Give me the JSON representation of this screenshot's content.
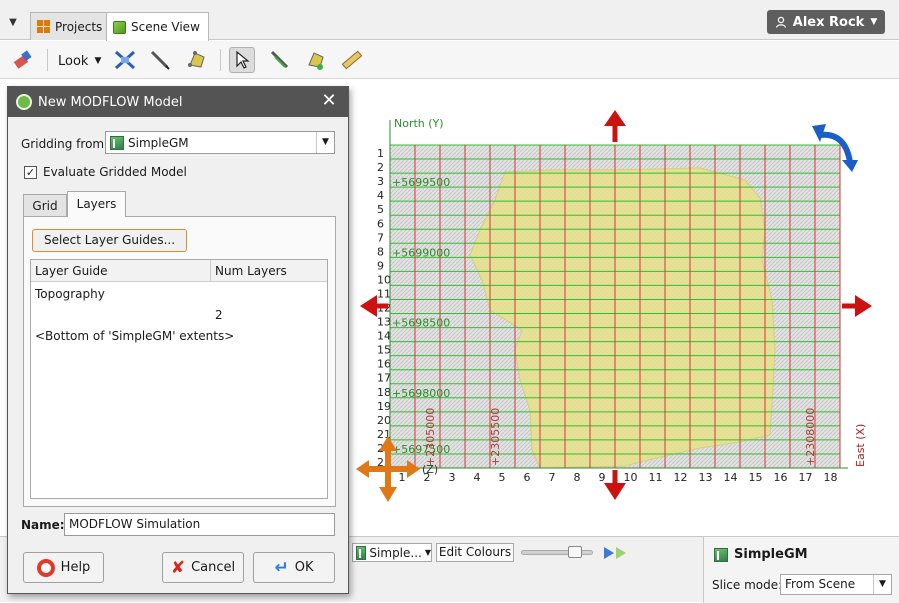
{
  "tabs": [
    {
      "label": "Projects",
      "icon": "projects-grid-icon"
    },
    {
      "label": "Scene View",
      "icon": "scene-cube-icon"
    }
  ],
  "user": {
    "name": "Alex Rock",
    "icon": "user-icon"
  },
  "toolbar": {
    "look_label": "Look"
  },
  "scene": {
    "north_label": "North (Y)",
    "east_label": "East (X)",
    "z_label": "(Z)",
    "row_labels": [
      "1",
      "2",
      "3",
      "4",
      "5",
      "6",
      "7",
      "8",
      "9",
      "10",
      "11",
      "12",
      "13",
      "14",
      "15",
      "16",
      "17",
      "18",
      "19",
      "20",
      "21",
      "22",
      "23"
    ],
    "col_labels": [
      "1",
      "2",
      "3",
      "4",
      "5",
      "6",
      "7",
      "8",
      "9",
      "10",
      "11",
      "12",
      "13",
      "14",
      "15",
      "16",
      "17",
      "18"
    ],
    "y_ticks": [
      "+5699500",
      "+5699000",
      "+5698500",
      "+5698000",
      "+5697500"
    ],
    "x_ticks": [
      "+2305000",
      "+2305500",
      "+2308000"
    ],
    "colors": {
      "grid_line": "#2fbf2f",
      "col_line": "#d43838",
      "fill": "#e6e08a",
      "axis": "#2a8f2a",
      "arrow": "#cc1111",
      "handle": "#e07818",
      "rotate": "#1a5fc8"
    }
  },
  "dialog": {
    "title": "New MODFLOW Model",
    "gridding_label": "Gridding from:",
    "gridding_value": "SimpleGM",
    "evaluate_label": "Evaluate Gridded Model",
    "evaluate_checked": "✓",
    "tab_grid": "Grid",
    "tab_layers": "Layers",
    "select_guides_label": "Select Layer Guides...",
    "table": {
      "headers": [
        "Layer Guide",
        "Num Layers"
      ],
      "guide_top": "Topography",
      "num_layers": "2",
      "guide_bottom": "<Bottom of 'SimpleGM' extents>"
    },
    "name_label": "Name:",
    "name_value": "MODFLOW Simulation",
    "help_label": "Help",
    "cancel_label": "Cancel",
    "ok_label": "OK"
  },
  "bottom": {
    "object_select": "Simple...",
    "edit_colours": "Edit Colours",
    "properties_title": "SimpleGM",
    "slice_label": "Slice mode:",
    "slice_value": "From Scene"
  }
}
